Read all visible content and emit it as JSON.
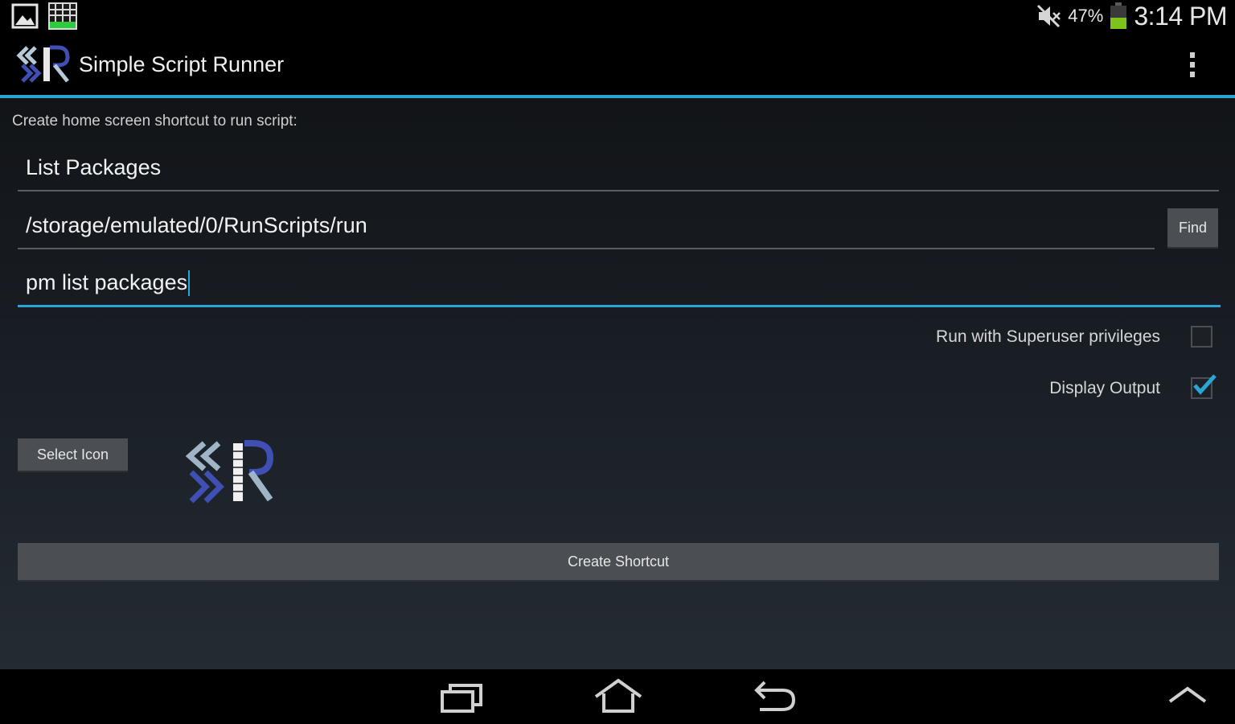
{
  "status_bar": {
    "battery_percent": "47%",
    "battery_level": 0.47,
    "time": "3:14 PM",
    "icons": [
      "gallery-icon",
      "grid-app-icon",
      "muted-icon",
      "battery-icon"
    ]
  },
  "action_bar": {
    "title": "Simple Script Runner",
    "logo_icon": "ssr-logo-icon",
    "menu_icon": "overflow-menu-icon"
  },
  "form": {
    "caption": "Create home screen shortcut to run script:",
    "shortcut_name": "List Packages",
    "script_path": "/storage/emulated/0/RunScripts/run",
    "command": "pm list packages",
    "find_label": "Find",
    "superuser_label": "Run with Superuser privileges",
    "superuser_checked": false,
    "display_output_label": "Display Output",
    "display_output_checked": true,
    "select_icon_label": "Select Icon",
    "create_shortcut_label": "Create Shortcut"
  },
  "nav_bar": {
    "icons": [
      "recents-icon",
      "home-icon",
      "back-icon",
      "up-arrow-icon"
    ]
  },
  "colors": {
    "accent": "#2aa5d6",
    "battery": "#7cc41c",
    "button": "#4b4e52"
  }
}
